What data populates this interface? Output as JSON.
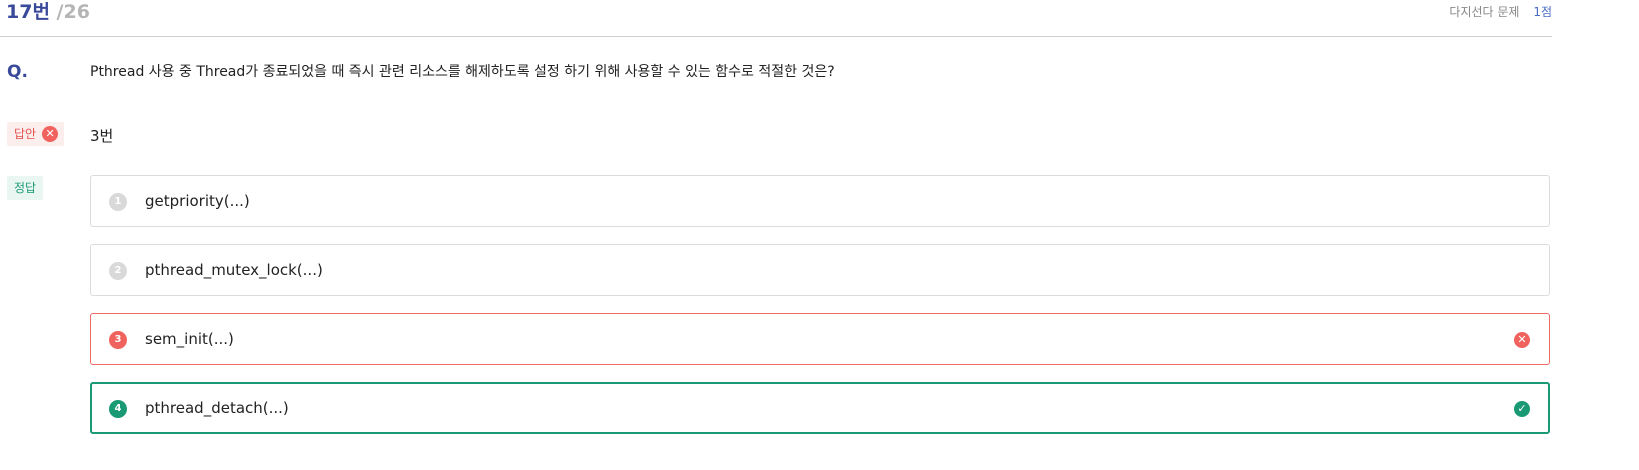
{
  "header": {
    "current": "17번",
    "total": "/26",
    "question_type": "다지선다 문제",
    "points": "1점"
  },
  "question": {
    "label": "Q.",
    "text": "Pthread 사용 중 Thread가 종료되었을 때 즉시 관련 리소스를 해제하도록 설정 하기 위해 사용할 수 있는 함수로 적절한 것은?"
  },
  "answer": {
    "tag": "답안",
    "value": "3번",
    "status_icon": "x-circle-icon"
  },
  "correct": {
    "tag": "정답"
  },
  "options": [
    {
      "number": "1",
      "text": "getpriority(...)",
      "state": "none"
    },
    {
      "number": "2",
      "text": "pthread_mutex_lock(...)",
      "state": "none"
    },
    {
      "number": "3",
      "text": "sem_init(...)",
      "state": "wrong"
    },
    {
      "number": "4",
      "text": "pthread_detach(...)",
      "state": "correct"
    }
  ],
  "colors": {
    "primary": "#3a4a9a",
    "wrong": "#f0625d",
    "correct": "#1a9a74",
    "points": "#4a6cc8"
  }
}
